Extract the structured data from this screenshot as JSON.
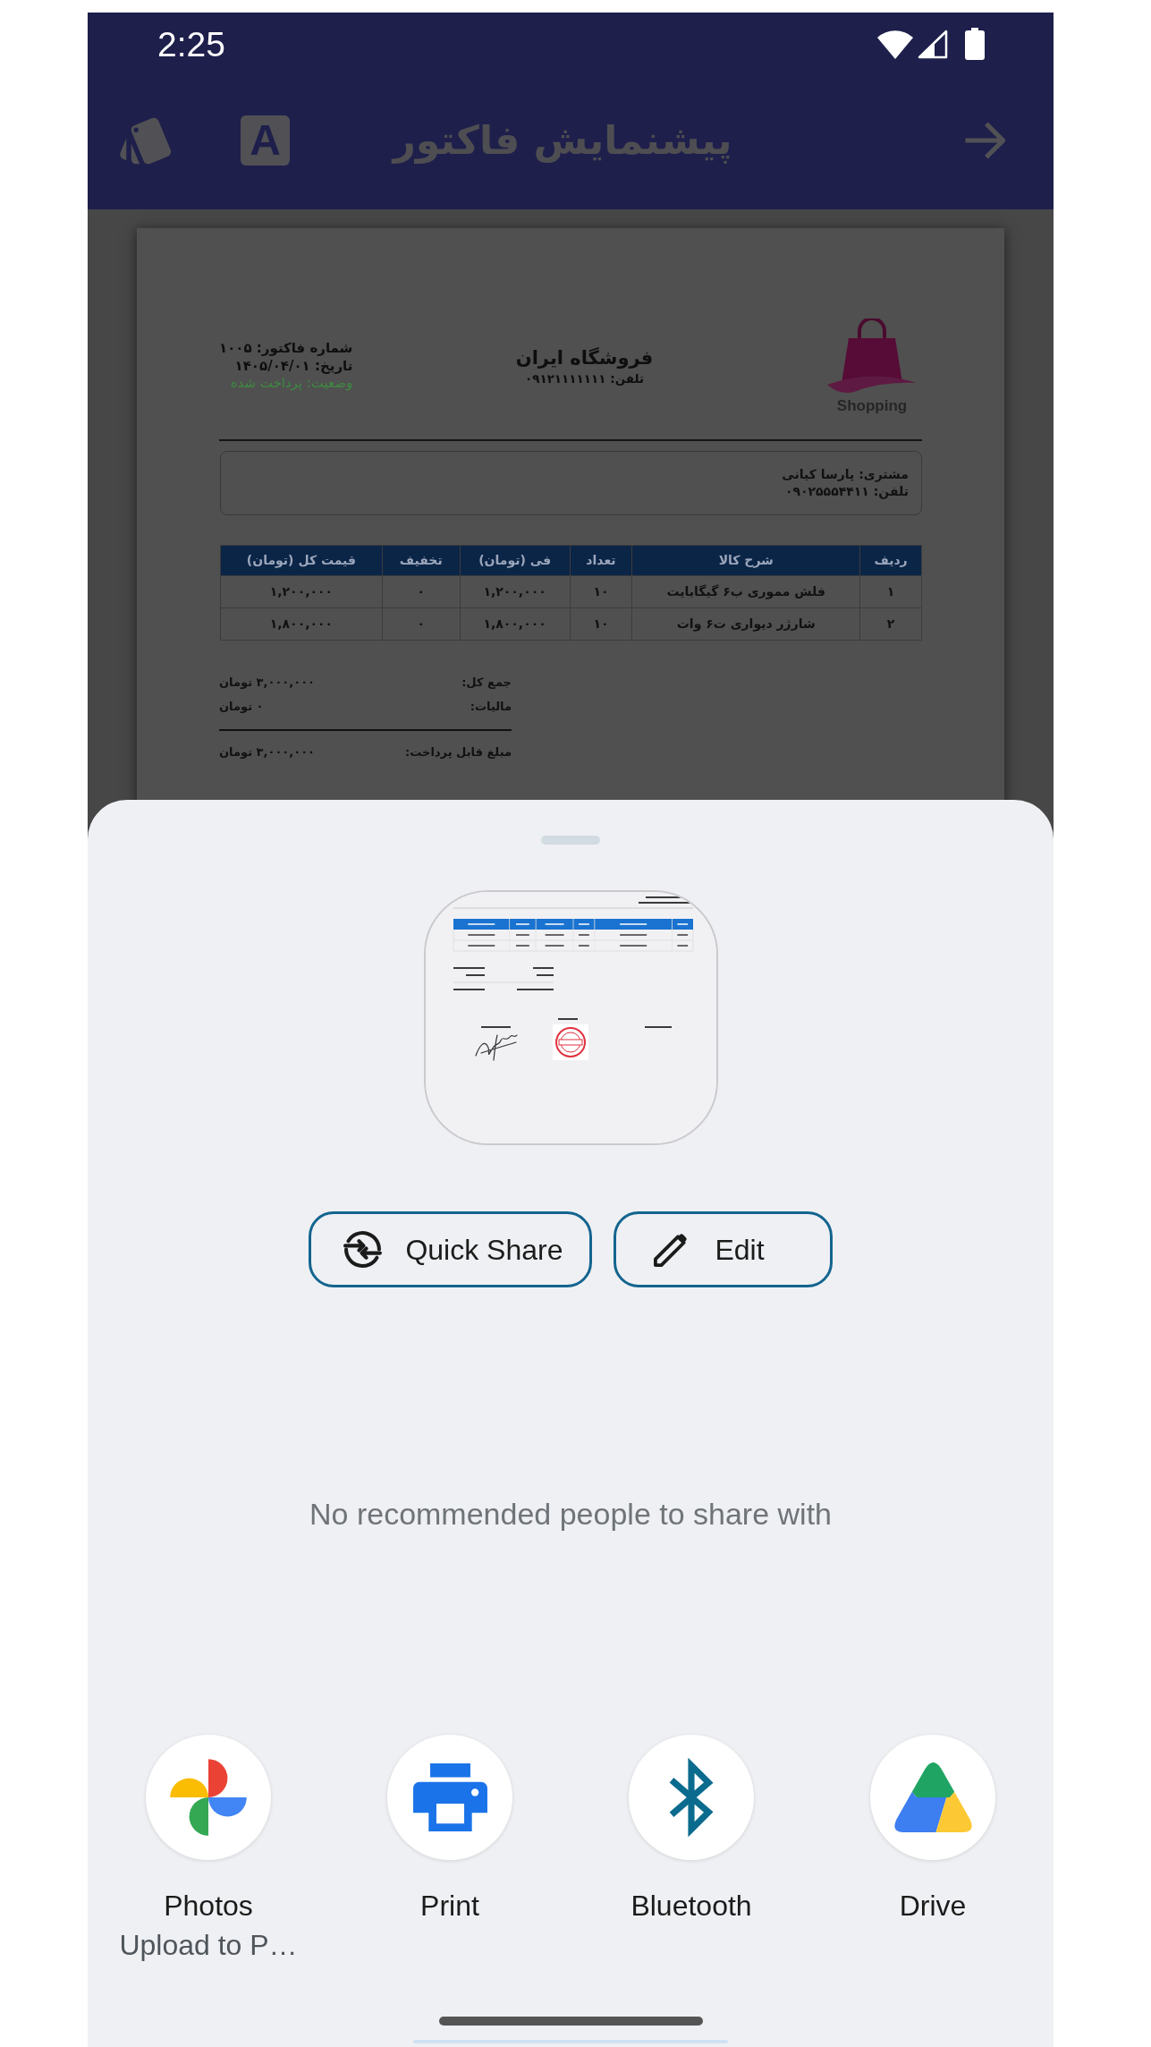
{
  "status_bar": {
    "time": "2:25"
  },
  "app_bar": {
    "title": "پیشنمایش فاکتور",
    "font_button": "A"
  },
  "invoice": {
    "logo": {
      "name": "Shopping"
    },
    "store": {
      "name": "فروشگاه ایران",
      "phone": "تلفن: ۰۹۱۲۱۱۱۱۱۱۱"
    },
    "meta": [
      {
        "kind": "text",
        "text": "شماره فاکتور: ۱۰۰۵"
      },
      {
        "kind": "text",
        "text": "تاریخ: ۱۴۰۵/۰۴/۰۱"
      },
      {
        "kind": "status",
        "text": "وضعیت: پرداخت شده"
      }
    ],
    "customer": [
      "مشتری: پارسا کیانی",
      "تلفن: ۰۹۰۲۵۵۵۴۴۱۱"
    ],
    "table": {
      "columns": [
        "ردیف",
        "شرح کالا",
        "تعداد",
        "فی (تومان)",
        "تخفیف",
        "قیمت کل (تومان)"
      ],
      "rows": [
        [
          "۱",
          "فلش مموری ب۶ گیگابایت",
          "۱۰",
          "۱,۲۰۰,۰۰۰",
          "۰",
          "۱,۲۰۰,۰۰۰"
        ],
        [
          "۲",
          "شارژر دیواری ت۶ وات",
          "۱۰",
          "۱,۸۰۰,۰۰۰",
          "۰",
          "۱,۸۰۰,۰۰۰"
        ]
      ]
    },
    "totals": [
      {
        "kind": "line",
        "label": "جمع کل:",
        "value": "۳,۰۰۰,۰۰۰ تومان"
      },
      {
        "kind": "line",
        "label": "مالیات:",
        "value": "۰ تومان"
      },
      {
        "kind": "grand",
        "label": "مبلغ قابل پرداخت:",
        "value": "۳,۰۰۰,۰۰۰ تومان"
      }
    ]
  },
  "share_sheet": {
    "quick_share_button": {
      "label": "Quick Share"
    },
    "edit_button": {
      "label": "Edit"
    },
    "empty_message": "No recommended people to share with",
    "apps": {
      "photos": {
        "label": "Photos",
        "sublabel": "Upload to P…"
      },
      "print": {
        "label": "Print"
      },
      "bluetooth": {
        "label": "Bluetooth"
      },
      "drive": {
        "label": "Drive"
      }
    }
  }
}
